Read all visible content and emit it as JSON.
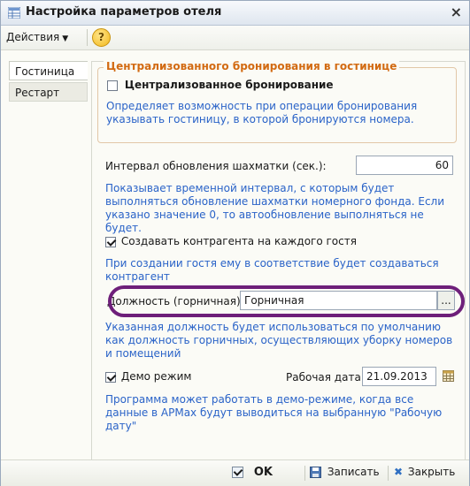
{
  "window": {
    "title": "Настройка параметров отеля",
    "title_icon": "settings-grid-icon",
    "close_glyph": "×"
  },
  "toolbar": {
    "actions_label": "Действия",
    "help_glyph": "?"
  },
  "tabs": [
    {
      "label": "Гостиница",
      "active": true
    },
    {
      "label": "Рестарт",
      "active": false
    }
  ],
  "booking_group": {
    "legend": "Централизованного бронирования в гостинице",
    "checkbox_label": "Централизованное бронирование",
    "checked": false,
    "hint": "Определяет возможность при операции бронирования указывать гостиницу, в которой бронируются номера."
  },
  "refresh": {
    "label": "Интервал обновления шахматки (сек.):",
    "value": "60",
    "hint": "Показывает временной интервал, с которым будет выполняться обновление шахматки номерного фонда. Если указано значение 0, то автообновление выполняться не будет."
  },
  "create_contractor": {
    "label": "Создавать контрагента на каждого гостя",
    "checked": true,
    "hint": "При создании гостя ему в соответствие будет создаваться контрагент"
  },
  "position": {
    "label": "Должность (горничная):",
    "value": "Горничная",
    "button_label": "...",
    "hint": "Указанная должность будет использоваться по умолчанию как должность горничных, осуществляющих уборку номеров и помещений"
  },
  "demo": {
    "label": "Демо режим",
    "checked": true,
    "date_label": "Рабочая дата:",
    "date_value": "21.09.2013",
    "hint": "Программа может работать в демо-режиме, когда все данные в АРМах будут выводиться на выбранную \"Рабочую дату\""
  },
  "footer": {
    "ok_label": "OK",
    "save_label": "Записать",
    "close_label": "Закрыть"
  },
  "colors": {
    "hint": "#2a63c8",
    "legend": "#d26a12",
    "highlight": "#6e1f7a"
  }
}
